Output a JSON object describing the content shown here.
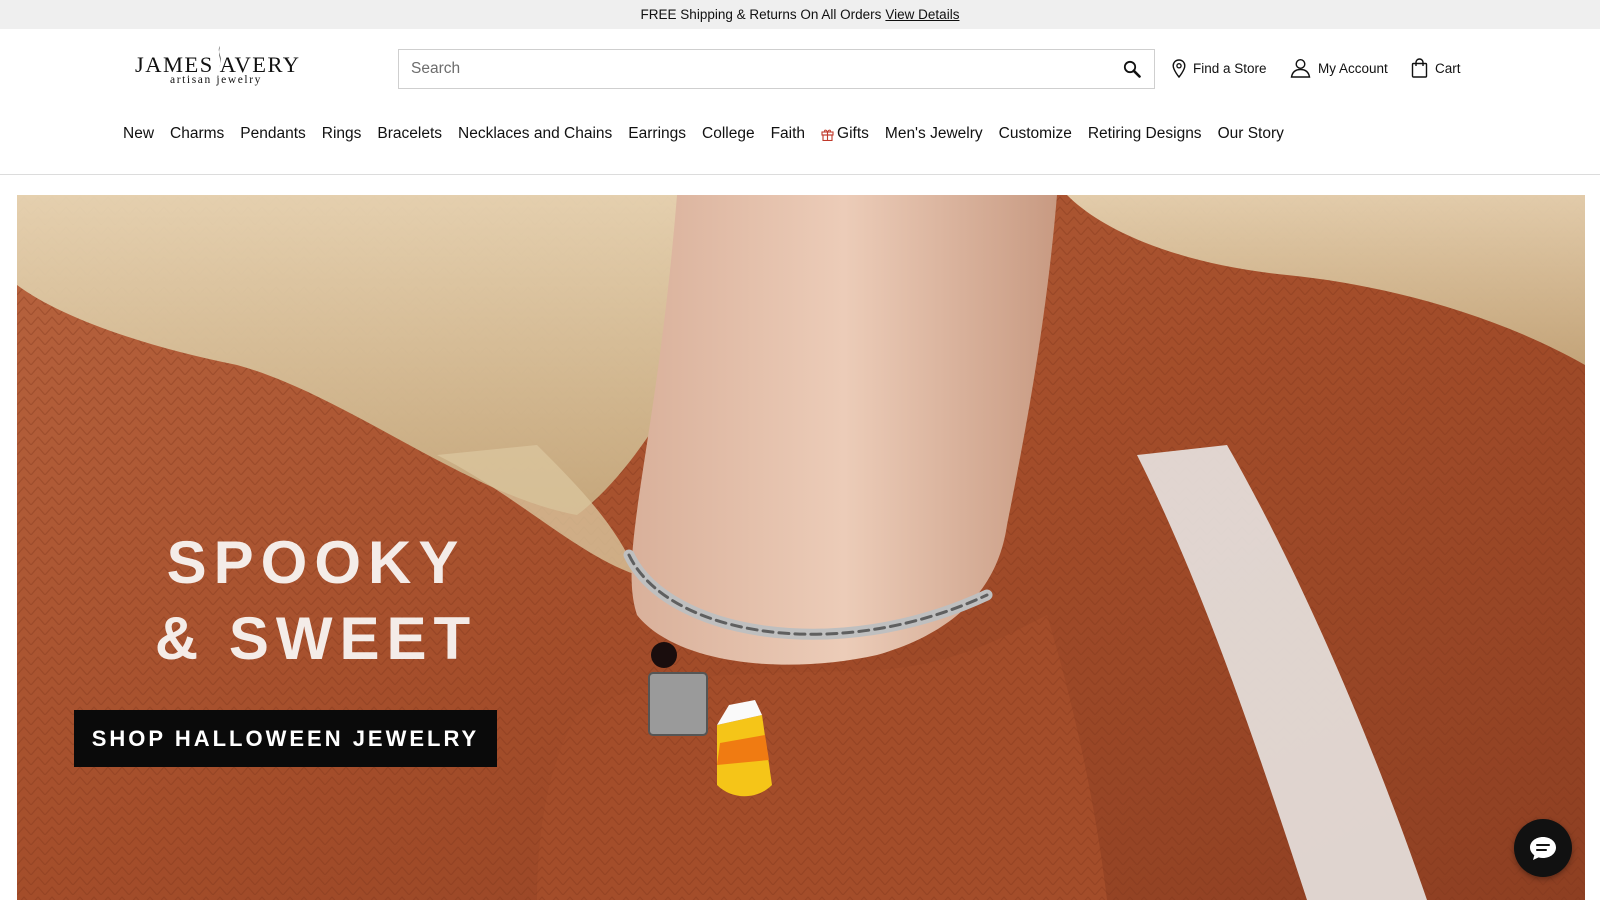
{
  "promo": {
    "text": "FREE Shipping & Returns On All Orders",
    "link": "View Details"
  },
  "brand": {
    "name": "JAMES AVERY",
    "tagline": "artisan jewelry"
  },
  "search": {
    "placeholder": "Search",
    "value": "",
    "icon": "search-icon"
  },
  "utility": {
    "find_store": "Find a Store",
    "account": "My Account",
    "cart": "Cart"
  },
  "nav": {
    "items": [
      "New",
      "Charms",
      "Pendants",
      "Rings",
      "Bracelets",
      "Necklaces and Chains",
      "Earrings",
      "College",
      "Faith",
      "Gifts",
      "Men's Jewelry",
      "Customize",
      "Retiring Designs",
      "Our Story"
    ]
  },
  "hero": {
    "title_line1": "SPOOKY",
    "title_line2": "& SWEET",
    "cta": "SHOP HALLOWEEN JEWELRY"
  },
  "colors": {
    "promo_bg": "#efefef",
    "cta_bg": "#0a0a0a",
    "gift_icon": "#c0392b",
    "sweater": "#a9522e"
  }
}
